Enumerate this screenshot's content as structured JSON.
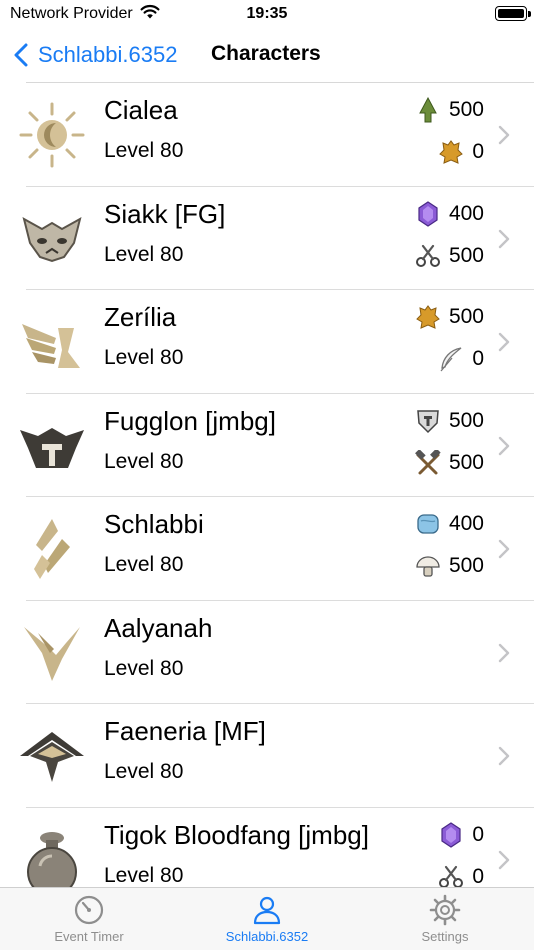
{
  "status_bar": {
    "carrier": "Network Provider",
    "time": "19:35",
    "icons": [
      "wifi-icon",
      "battery-icon"
    ]
  },
  "nav": {
    "back_label": "Schlabbi.6352",
    "title": "Characters"
  },
  "characters": [
    {
      "name": "Cialea",
      "level": "Level 80",
      "emblem": "sun-emblem-icon",
      "currencies": [
        {
          "icon": "spirit-shard-icon",
          "value": "500"
        },
        {
          "icon": "leather-icon",
          "value": "0"
        }
      ]
    },
    {
      "name": "Siakk [FG]",
      "level": "Level 80",
      "emblem": "mask-emblem-icon",
      "currencies": [
        {
          "icon": "gem-icon",
          "value": "400"
        },
        {
          "icon": "scissors-icon",
          "value": "500"
        }
      ]
    },
    {
      "name": "Zerília",
      "level": "Level 80",
      "emblem": "wing-emblem-icon",
      "currencies": [
        {
          "icon": "leather-icon",
          "value": "500"
        },
        {
          "icon": "feather-icon",
          "value": "0"
        }
      ]
    },
    {
      "name": "Fugglon [jmbg]",
      "level": "Level 80",
      "emblem": "helmet-emblem-icon",
      "currencies": [
        {
          "icon": "shield-icon",
          "value": "500"
        },
        {
          "icon": "crossed-tools-icon",
          "value": "500"
        }
      ]
    },
    {
      "name": "Schlabbi",
      "level": "Level 80",
      "emblem": "shard-emblem-icon",
      "currencies": [
        {
          "icon": "cloth-icon",
          "value": "400"
        },
        {
          "icon": "mushroom-icon",
          "value": "500"
        }
      ]
    },
    {
      "name": "Aalyanah",
      "level": "Level 80",
      "emblem": "claw-emblem-icon",
      "currencies": []
    },
    {
      "name": "Faeneria [MF]",
      "level": "Level 80",
      "emblem": "hat-emblem-icon",
      "currencies": []
    },
    {
      "name": "Tigok Bloodfang [jmbg]",
      "level": "Level 80",
      "emblem": "bomb-emblem-icon",
      "currencies": [
        {
          "icon": "gem-icon",
          "value": "0"
        },
        {
          "icon": "scissors-icon",
          "value": "0"
        }
      ]
    }
  ],
  "tabs": [
    {
      "label": "Event Timer",
      "icon": "timer-icon",
      "active": false
    },
    {
      "label": "Schlabbi.6352",
      "icon": "person-icon",
      "active": true
    },
    {
      "label": "Settings",
      "icon": "gear-icon",
      "active": false
    }
  ],
  "colors": {
    "accent": "#1a7cf4",
    "emblem_gold": "#c8b58a",
    "tab_inactive": "#8e8e8e"
  }
}
